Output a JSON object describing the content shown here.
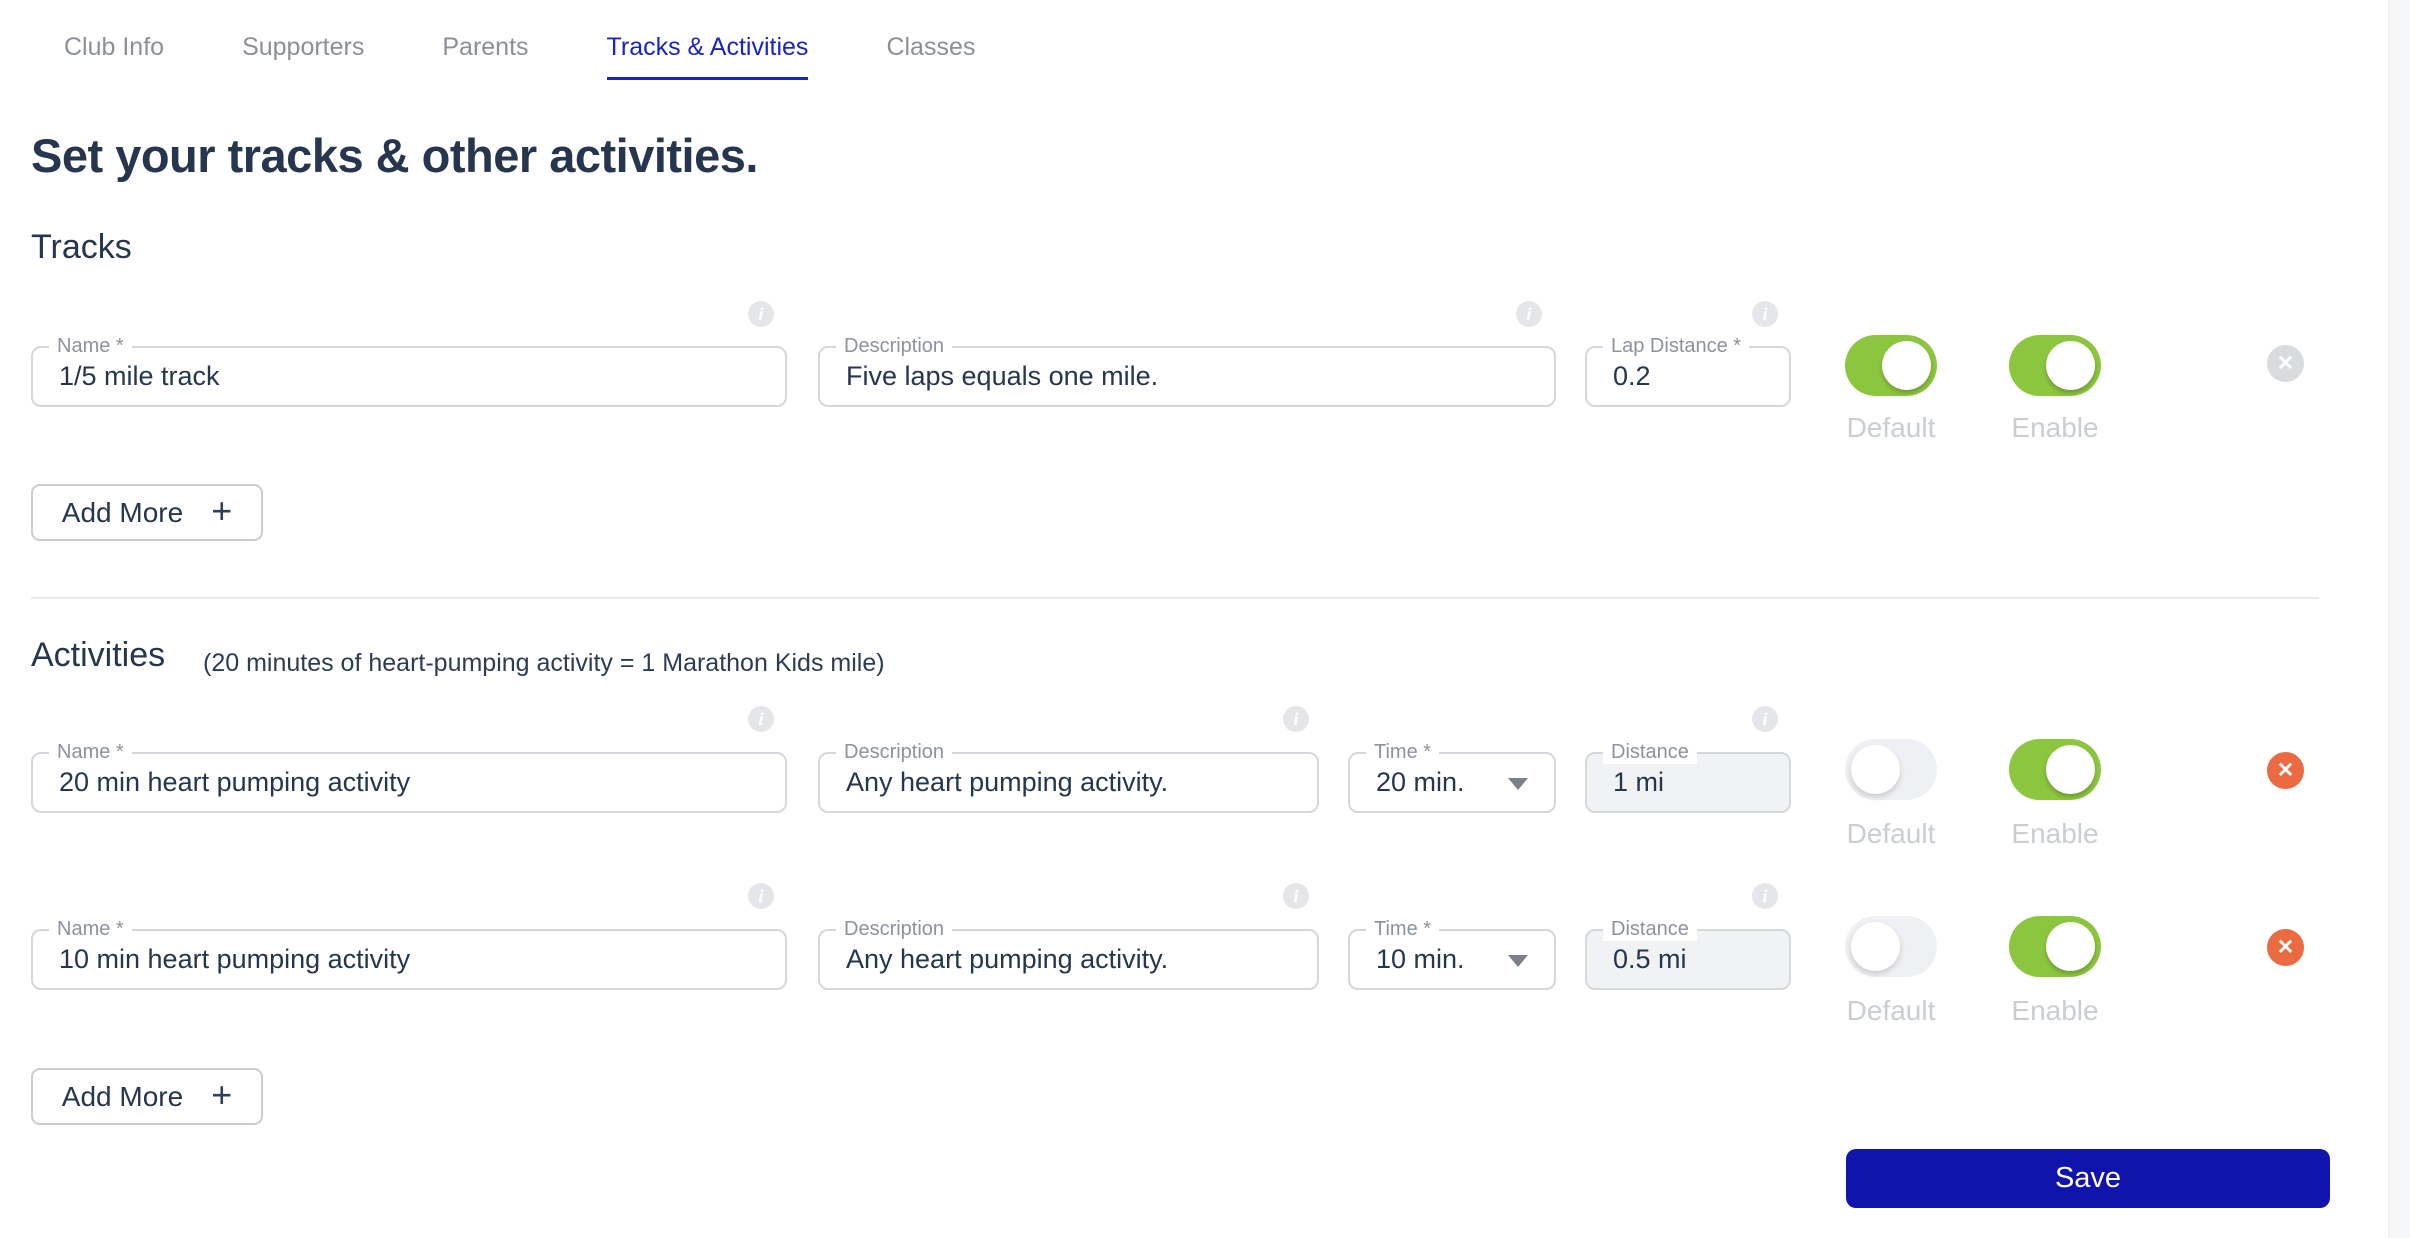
{
  "tabs": [
    {
      "label": "Club Info",
      "active": false
    },
    {
      "label": "Supporters",
      "active": false
    },
    {
      "label": "Parents",
      "active": false
    },
    {
      "label": "Tracks & Activities",
      "active": true
    },
    {
      "label": "Classes",
      "active": false
    }
  ],
  "page_title": "Set your tracks & other activities.",
  "tracks_section": {
    "title": "Tracks",
    "add_more_label": "Add More",
    "add_more_icon": "+",
    "rows": [
      {
        "name_label": "Name *",
        "name_value": "1/5 mile track",
        "description_label": "Description",
        "description_value": "Five laps equals one mile.",
        "lap_distance_label": "Lap Distance *",
        "lap_distance_value": "0.2",
        "default_label": "Default",
        "default_on": true,
        "enable_label": "Enable",
        "enable_on": true,
        "remove_icon": "✕"
      }
    ]
  },
  "activities_section": {
    "title": "Activities",
    "subtitle": "(20 minutes of heart-pumping activity = 1 Marathon Kids mile)",
    "add_more_label": "Add More",
    "add_more_icon": "+",
    "rows": [
      {
        "name_label": "Name *",
        "name_value": "20 min heart pumping activity",
        "description_label": "Description",
        "description_value": "Any heart pumping activity.",
        "time_label": "Time *",
        "time_value": "20 min.",
        "distance_label": "Distance",
        "distance_value": "1 mi",
        "default_label": "Default",
        "default_on": false,
        "enable_label": "Enable",
        "enable_on": true,
        "remove_icon": "✕"
      },
      {
        "name_label": "Name *",
        "name_value": "10 min heart pumping activity",
        "description_label": "Description",
        "description_value": "Any heart pumping activity.",
        "time_label": "Time *",
        "time_value": "10 min.",
        "distance_label": "Distance",
        "distance_value": "0.5 mi",
        "default_label": "Default",
        "default_on": false,
        "enable_label": "Enable",
        "enable_on": true,
        "remove_icon": "✕"
      }
    ]
  },
  "info_icon_glyph": "i",
  "save_label": "Save",
  "colors": {
    "accent_blue": "#1a25c1",
    "save_blue": "#1113ad",
    "toggle_green": "#8cc63f",
    "delete_red": "#ec6a41",
    "text_navy": "#25364e",
    "label_gray": "#8d939b",
    "toggle_off_gray": "#eef0f3",
    "disabled_field_gray": "#f1f2f3"
  }
}
